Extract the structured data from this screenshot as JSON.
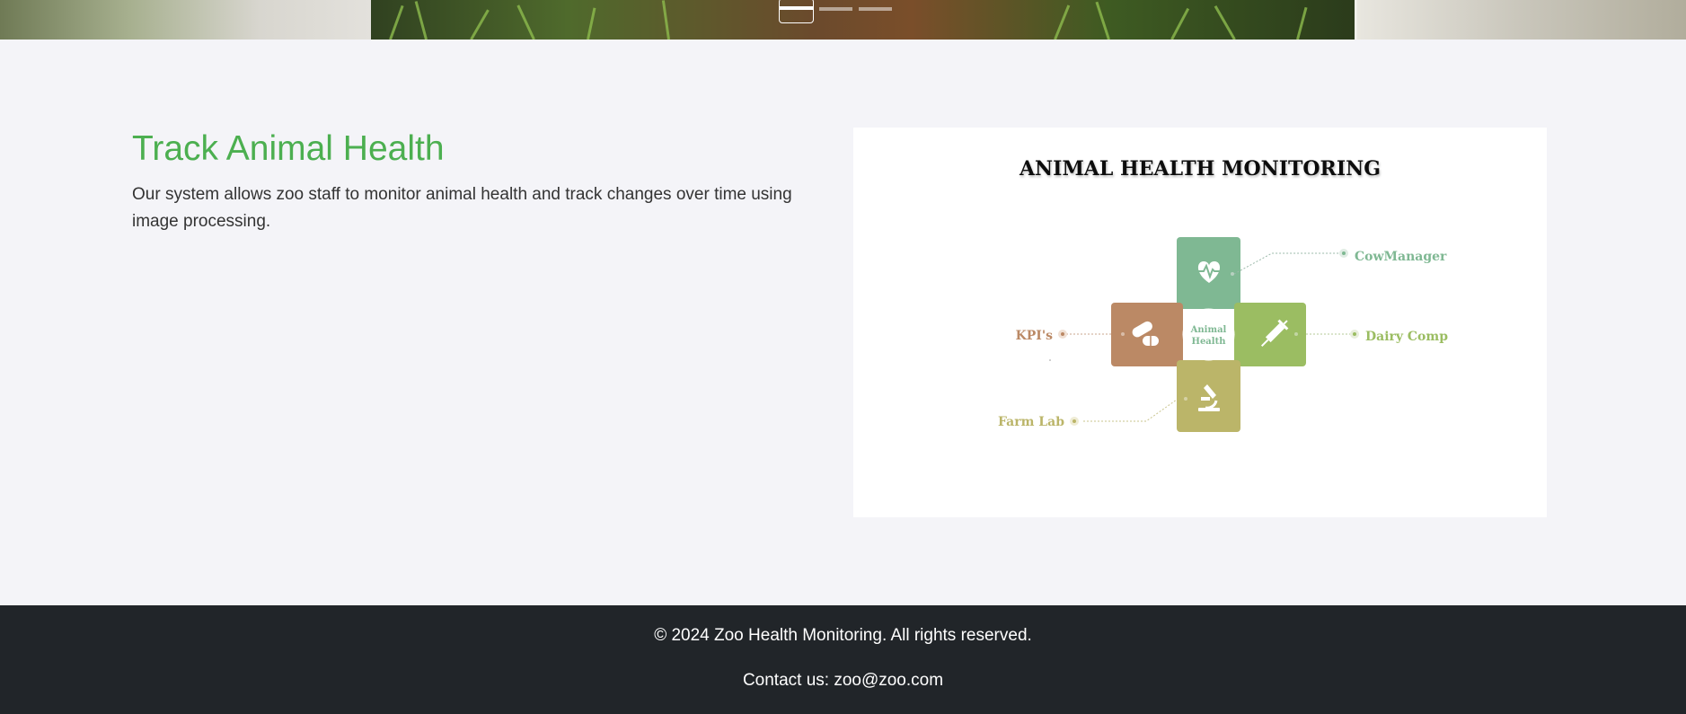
{
  "carousel": {
    "slides": [
      "slide-1",
      "slide-2",
      "slide-3"
    ],
    "active_index": 0
  },
  "section": {
    "title": "Track Animal Health",
    "description": "Our system allows zoo staff to monitor animal health and track changes over time using image processing."
  },
  "infographic": {
    "title": "ANIMAL HEALTH MONITORING",
    "center_label_line1": "Animal",
    "center_label_line2": "Health",
    "labels": {
      "top": "CowManager",
      "right": "Dairy Comp",
      "left": "KPI's",
      "bottom": "Farm Lab"
    },
    "colors": {
      "top": "#7fb893",
      "right": "#9bbd62",
      "left": "#bb8965",
      "bottom": "#bbb569"
    }
  },
  "footer": {
    "copyright": "© 2024 Zoo Health Monitoring. All rights reserved.",
    "contact": "Contact us: zoo@zoo.com"
  }
}
